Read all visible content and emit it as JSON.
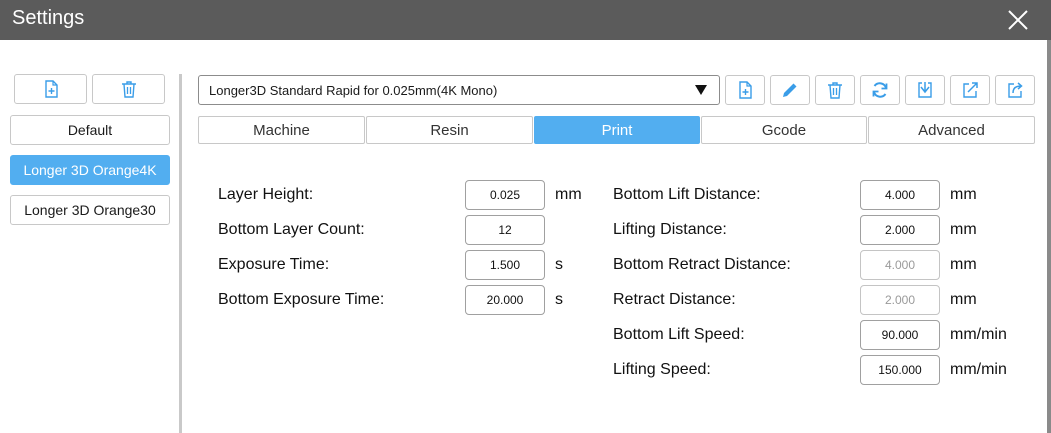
{
  "window": {
    "title": "Settings"
  },
  "machines": {
    "items": [
      {
        "label": "Default",
        "selected": false
      },
      {
        "label": "Longer 3D Orange4K",
        "selected": true
      },
      {
        "label": "Longer 3D Orange30",
        "selected": false
      }
    ]
  },
  "profile": {
    "selected": "Longer3D Standard Rapid for 0.025mm(4K Mono)"
  },
  "tabs": [
    {
      "label": "Machine",
      "active": false
    },
    {
      "label": "Resin",
      "active": false
    },
    {
      "label": "Print",
      "active": true
    },
    {
      "label": "Gcode",
      "active": false
    },
    {
      "label": "Advanced",
      "active": false
    }
  ],
  "print": {
    "left": [
      {
        "label": "Layer Height:",
        "value": "0.025",
        "unit": "mm"
      },
      {
        "label": "Bottom Layer Count:",
        "value": "12",
        "unit": ""
      },
      {
        "label": "Exposure Time:",
        "value": "1.500",
        "unit": "s"
      },
      {
        "label": "Bottom Exposure Time:",
        "value": "20.000",
        "unit": "s"
      }
    ],
    "right": [
      {
        "label": "Bottom Lift Distance:",
        "value": "4.000",
        "unit": "mm",
        "disabled": false
      },
      {
        "label": "Lifting Distance:",
        "value": "2.000",
        "unit": "mm",
        "disabled": false
      },
      {
        "label": "Bottom Retract Distance:",
        "value": "4.000",
        "unit": "mm",
        "disabled": true
      },
      {
        "label": "Retract Distance:",
        "value": "2.000",
        "unit": "mm",
        "disabled": true
      },
      {
        "label": "Bottom Lift Speed:",
        "value": "90.000",
        "unit": "mm/min",
        "disabled": false
      },
      {
        "label": "Lifting Speed:",
        "value": "150.000",
        "unit": "mm/min",
        "disabled": false
      }
    ]
  },
  "colors": {
    "accent": "#52aef0",
    "titlebar": "#5b5b5b",
    "icon": "#3a9de8"
  }
}
